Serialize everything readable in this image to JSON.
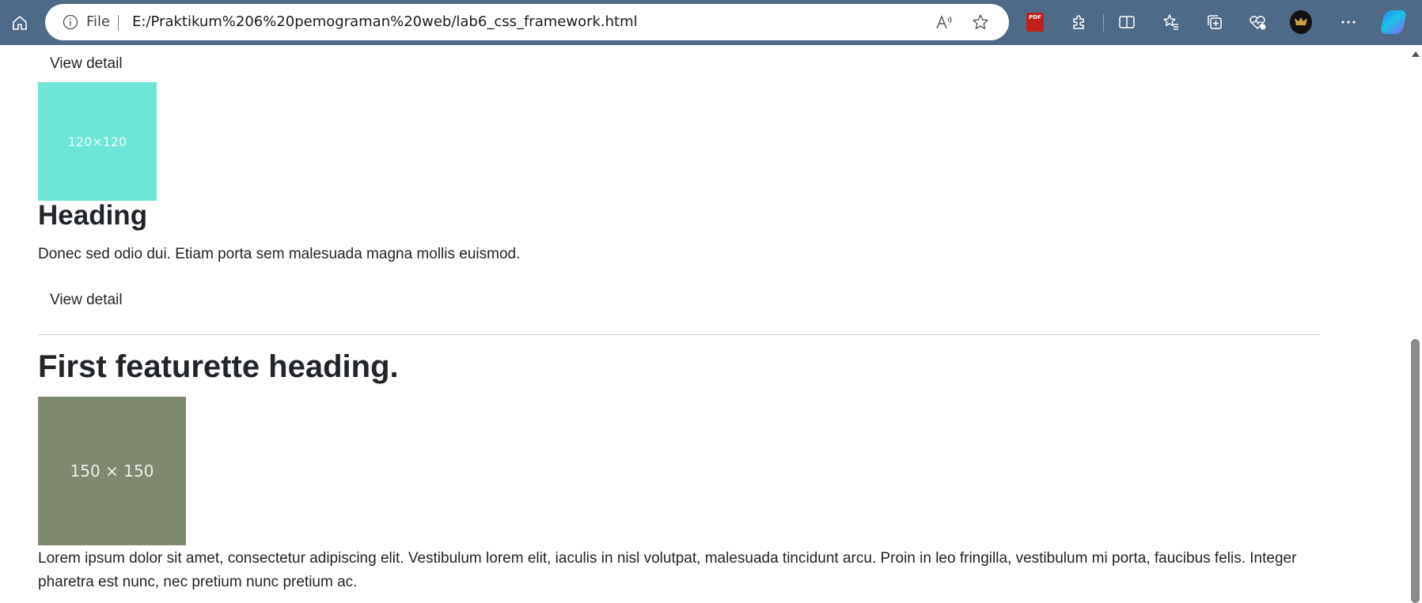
{
  "browser": {
    "file_label": "File",
    "url": "E:/Praktikum%206%20pemograman%20web/lab6_css_framework.html",
    "pdf_badge": "PDF",
    "icons": [
      "home-icon",
      "info-icon",
      "read-aloud-icon",
      "favorite-star-icon",
      "pdf-extension-icon",
      "extensions-icon",
      "split-screen-icon",
      "favorites-icon",
      "collections-icon",
      "browser-essentials-icon",
      "profile-avatar",
      "more-options-icon",
      "copilot-icon"
    ]
  },
  "content": {
    "view_detail_top": "View detail",
    "thumb_small_label": "120×120",
    "thumb_small_color": "#6ee7d6",
    "heading": "Heading",
    "heading_text": "Donec sed odio dui. Etiam porta sem malesuada magna mollis euismod.",
    "view_detail_bottom": "View detail",
    "featurette_heading": "First featurette heading.",
    "thumb_large_label": "150 × 150",
    "thumb_large_color": "#7e8970",
    "lorem": "Lorem ipsum dolor sit amet, consectetur adipiscing elit. Vestibulum lorem elit, iaculis in nisl volutpat, malesuada tincidunt arcu. Proin in leo fringilla, vestibulum mi porta, faucibus felis. Integer pharetra est nunc, nec pretium nunc pretium ac."
  }
}
